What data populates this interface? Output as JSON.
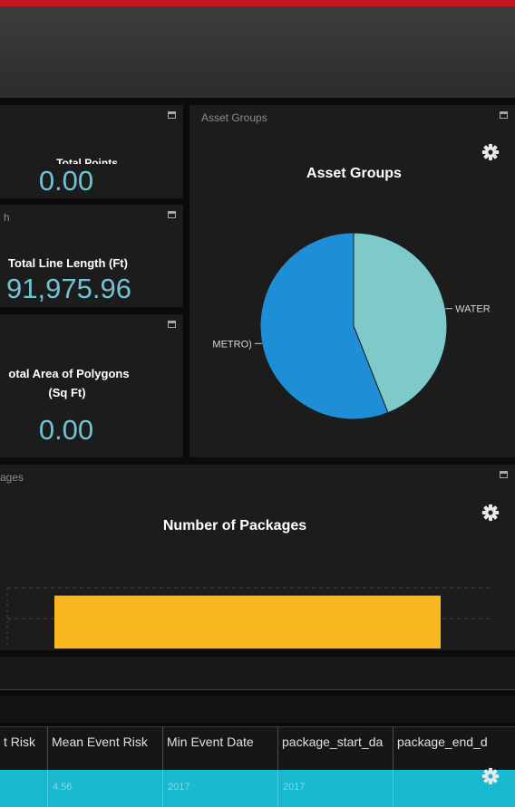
{
  "panels": {
    "points": {
      "title": "",
      "label": "Total Points",
      "value": "0.00"
    },
    "length": {
      "title": "h",
      "label": "Total Line Length (Ft)",
      "value": "91,975.96"
    },
    "area": {
      "title": "",
      "label_line1": "otal Area of Polygons",
      "label_line2": "(Sq Ft)",
      "value": "0.00"
    },
    "asset_groups": {
      "title": "Asset Groups"
    },
    "packages": {
      "title": "ages"
    }
  },
  "chart_data": [
    {
      "type": "pie",
      "title": "Asset Groups",
      "labels": [
        "WATER",
        "METRO)"
      ],
      "values": [
        44,
        56
      ],
      "colors": [
        "#7ec9c9",
        "#1e8fd6"
      ]
    },
    {
      "type": "bar",
      "title": "Number of Packages",
      "categories": [
        ""
      ],
      "values": [
        1
      ],
      "ylim": [
        0,
        1.25
      ],
      "colors": [
        "#f9b820"
      ]
    }
  ],
  "table": {
    "headers": [
      "t Risk",
      "Mean Event Risk",
      "Min Event Date",
      "package_start_da",
      "package_end_d"
    ],
    "row": [
      "",
      "4.56",
      "2017",
      "2017",
      ""
    ]
  },
  "colors": {
    "accent": "#c4161c",
    "value_text": "#6fc3d4",
    "row_highlight": "#19b9cf"
  },
  "icons": [
    "maximize-icon",
    "gear-icon"
  ]
}
